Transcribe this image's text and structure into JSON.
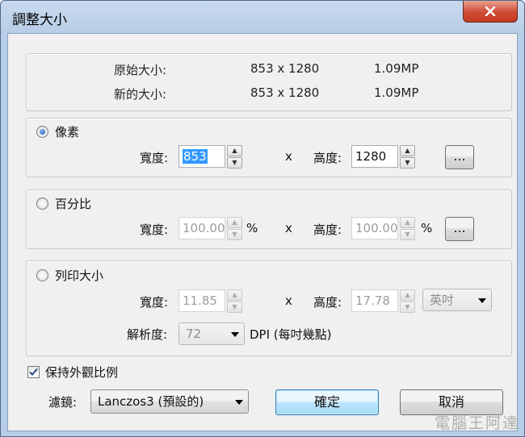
{
  "window": {
    "title": "調整大小"
  },
  "info": {
    "original_label": "原始大小:",
    "original_dims": "853 x 1280",
    "original_mp": "1.09MP",
    "new_label": "新的大小:",
    "new_dims": "853 x 1280",
    "new_mp": "1.09MP"
  },
  "pixels": {
    "label": "像素",
    "width_label": "寬度:",
    "width_value": "853",
    "x": "x",
    "height_label": "高度:",
    "height_value": "1280",
    "more": "..."
  },
  "percent": {
    "label": "百分比",
    "width_label": "寬度:",
    "width_value": "100.00",
    "unit": "%",
    "x": "x",
    "height_label": "高度:",
    "height_value": "100.00",
    "unit2": "%",
    "more": "..."
  },
  "print": {
    "label": "列印大小",
    "width_label": "寬度:",
    "width_value": "11.85",
    "x": "x",
    "height_label": "高度:",
    "height_value": "17.78",
    "unit_select": "英吋",
    "resolution_label": "解析度:",
    "resolution_value": "72",
    "dpi_label": "DPI (每吋幾點)"
  },
  "keep_aspect": {
    "label": "保持外觀比例",
    "checked": true
  },
  "filter": {
    "label": "濾鏡:",
    "value": "Lanczos3 (預設的)"
  },
  "buttons": {
    "ok": "確定",
    "cancel": "取消"
  },
  "watermark": "電腦王阿達"
}
